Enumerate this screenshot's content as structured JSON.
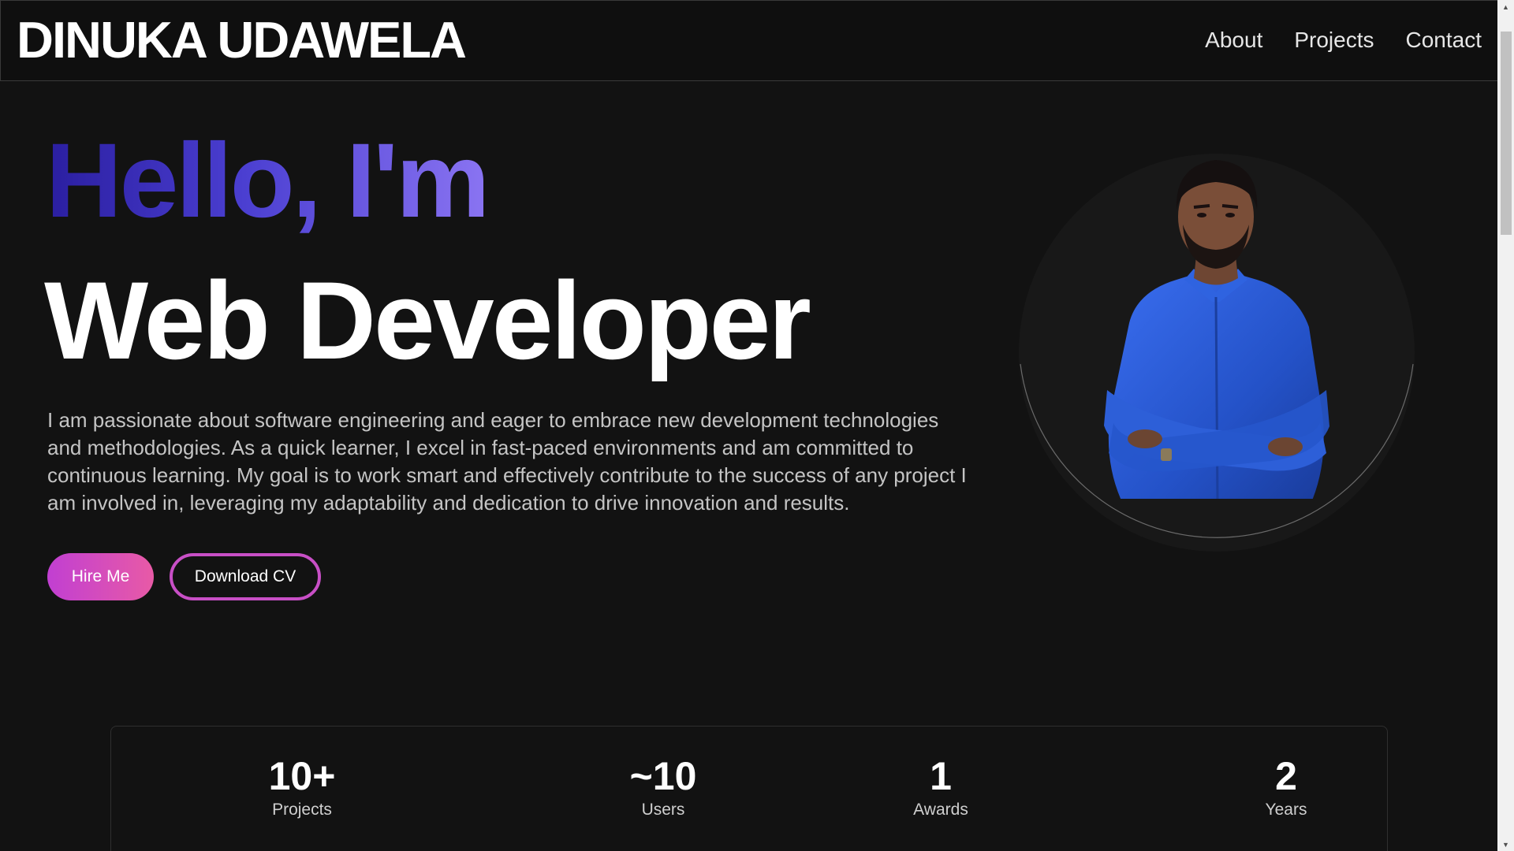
{
  "header": {
    "logo": "DINUKA UDAWELA",
    "nav": [
      {
        "label": "About"
      },
      {
        "label": "Projects"
      },
      {
        "label": "Contact"
      }
    ]
  },
  "hero": {
    "greeting": "Hello, I'm",
    "role": "Web Developer",
    "bio": "I am passionate about software engineering and eager to embrace new development technologies and methodologies. As a quick learner, I excel in fast-paced environments and am committed to continuous learning. My goal is to work smart and effectively contribute to the success of any project I am involved in, leveraging my adaptability and dedication to drive innovation and results.",
    "hire_label": "Hire Me",
    "cv_label": "Download CV",
    "portrait_icon": "person-photo"
  },
  "stats": [
    {
      "value": "10+",
      "label": "Projects"
    },
    {
      "value": "~10",
      "label": "Users"
    },
    {
      "value": "1",
      "label": "Awards"
    },
    {
      "value": "2",
      "label": "Years"
    }
  ],
  "colors": {
    "background": "#121212",
    "greeting_gradient_start": "#2a1ea0",
    "greeting_gradient_end": "#8a74f2",
    "button_gradient_start": "#c13fd2",
    "button_gradient_end": "#e85aa6",
    "shirt": "#2b5fd6"
  }
}
